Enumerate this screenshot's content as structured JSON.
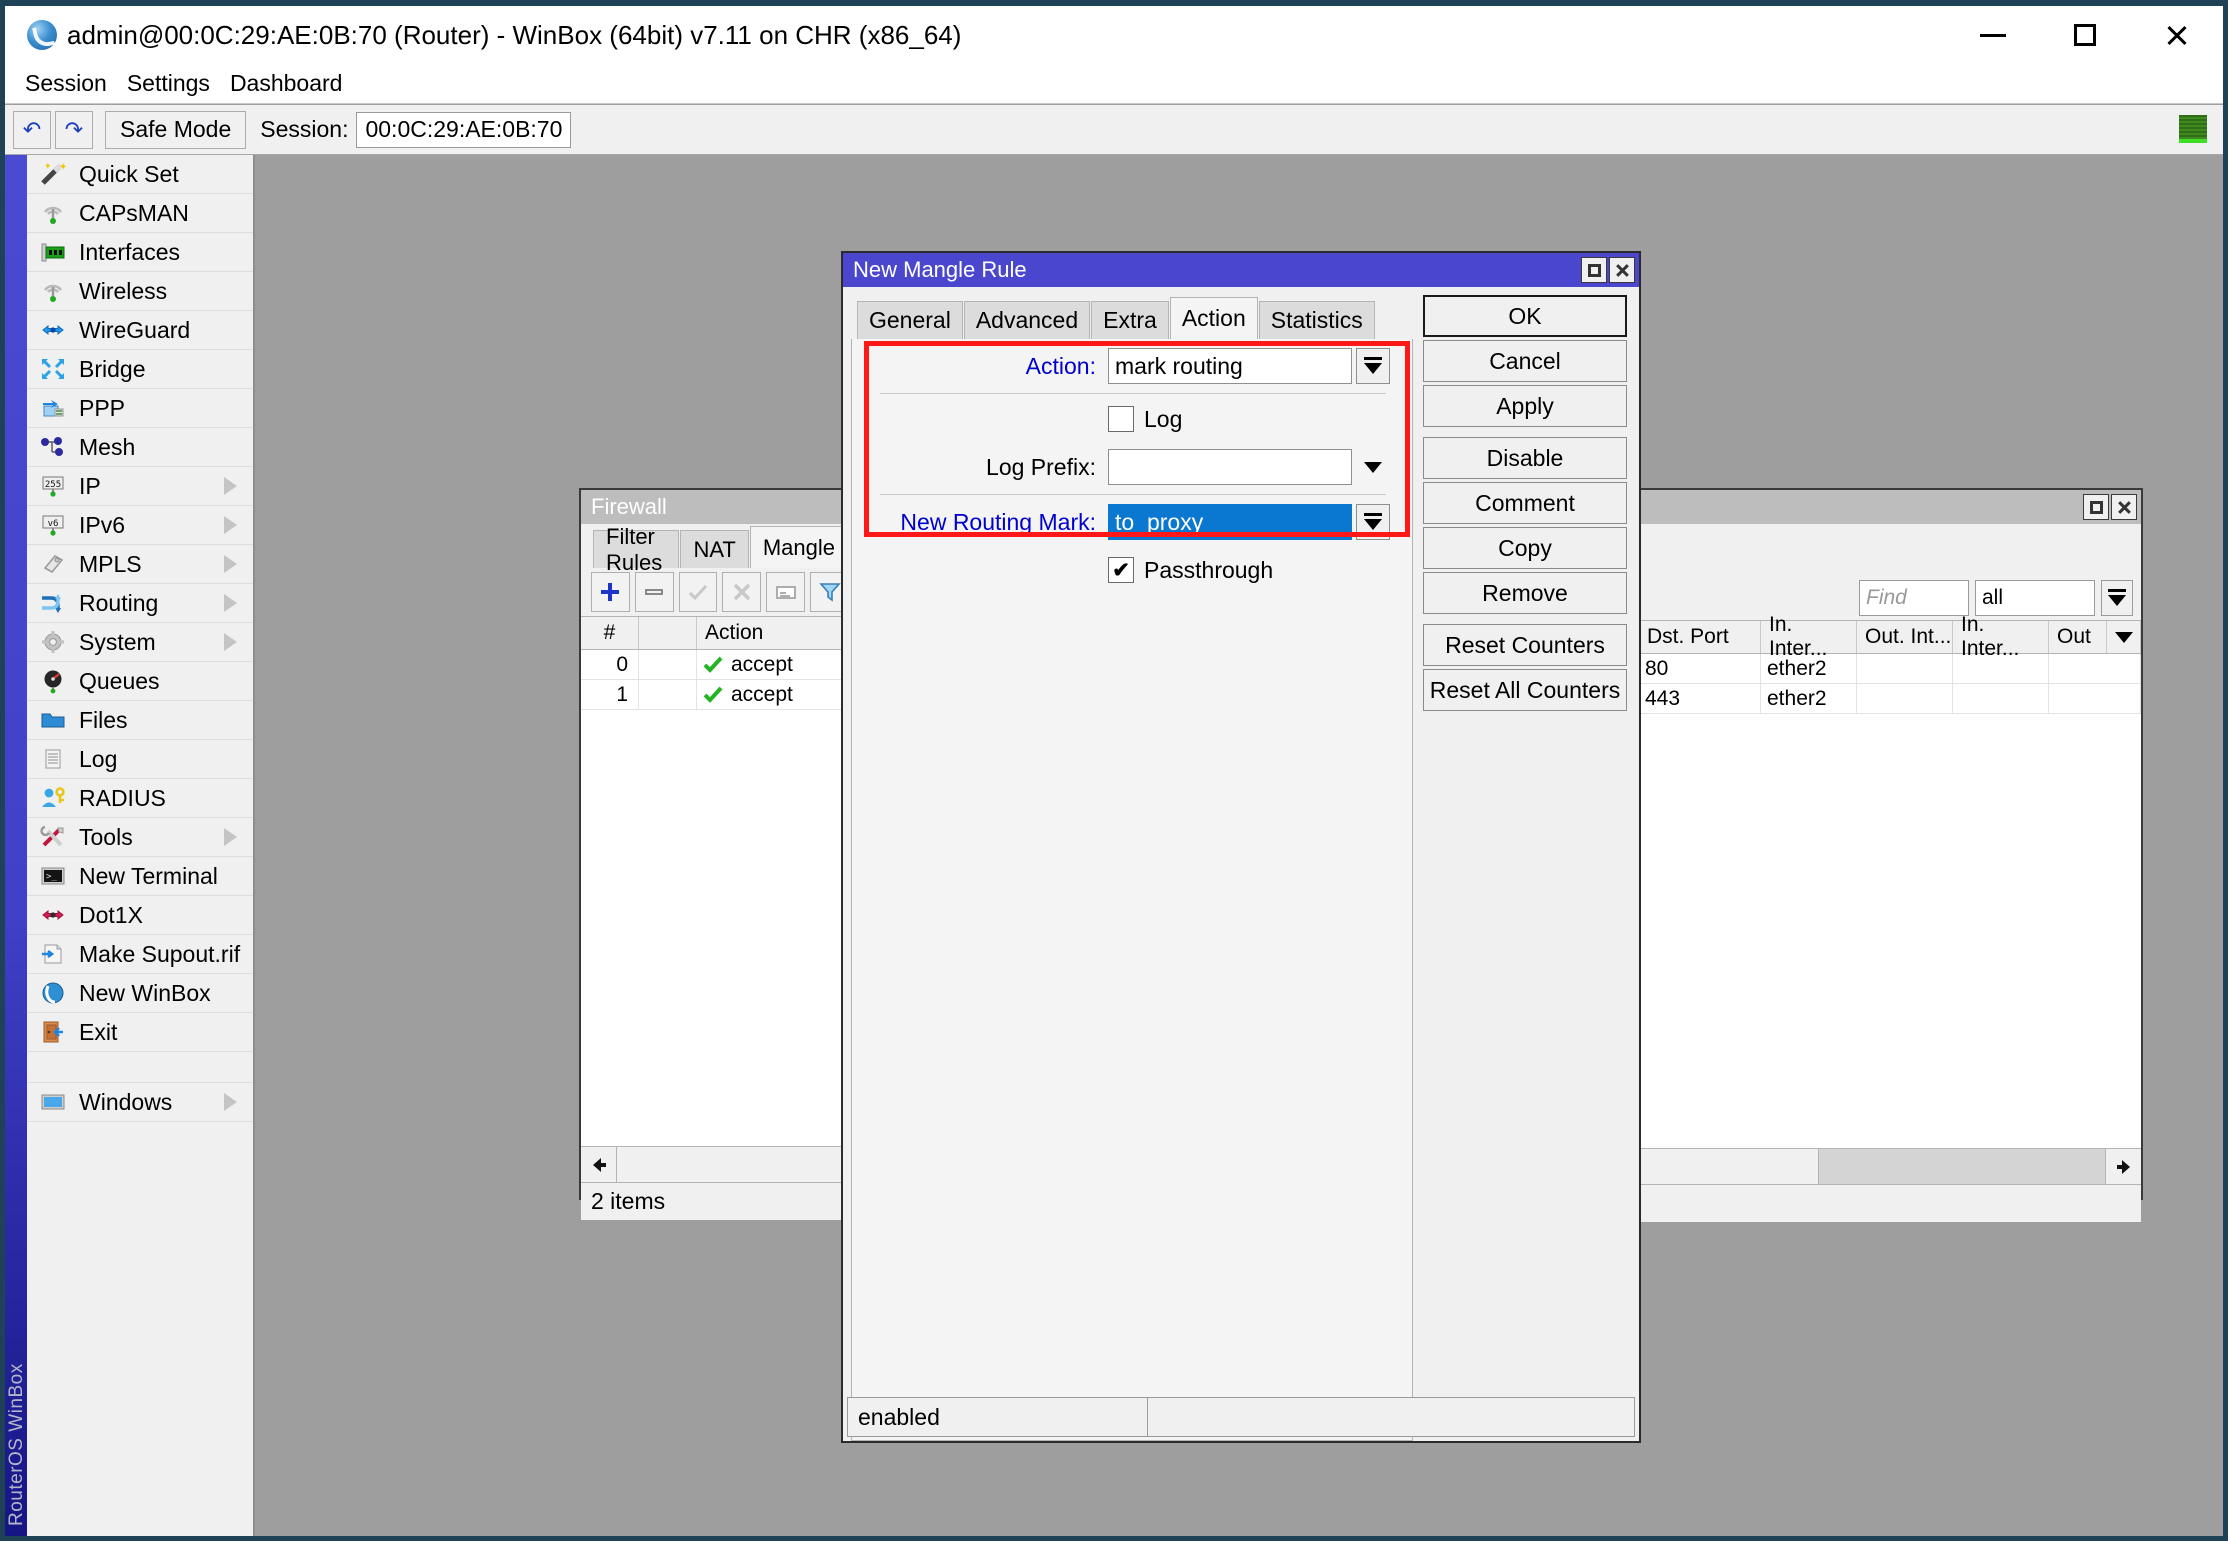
{
  "window": {
    "title": "admin@00:0C:29:AE:0B:70 (Router) - WinBox (64bit) v7.11 on CHR (x86_64)",
    "icon": "winbox-globe-icon",
    "minimize": "–",
    "maximize": "□",
    "close": "✕"
  },
  "menubar": {
    "items": [
      {
        "label": "Session"
      },
      {
        "label": "Settings"
      },
      {
        "label": "Dashboard"
      }
    ]
  },
  "toolbar": {
    "undo_icon": "↶",
    "redo_icon": "↷",
    "safe_mode": "Safe Mode",
    "session_label": "Session:",
    "session_value": "00:0C:29:AE:0B:70"
  },
  "sidebar": {
    "brand": "RouterOS WinBox",
    "items": [
      {
        "label": "Quick Set",
        "icon": "wand-icon",
        "arrow": false
      },
      {
        "label": "CAPsMAN",
        "icon": "antenna-icon",
        "arrow": false
      },
      {
        "label": "Interfaces",
        "icon": "nic-card-icon",
        "arrow": false
      },
      {
        "label": "Wireless",
        "icon": "antenna-icon",
        "arrow": false
      },
      {
        "label": "WireGuard",
        "icon": "wireguard-icon",
        "arrow": false
      },
      {
        "label": "Bridge",
        "icon": "bridge-icon",
        "arrow": false
      },
      {
        "label": "PPP",
        "icon": "ppp-icon",
        "arrow": false
      },
      {
        "label": "Mesh",
        "icon": "mesh-icon",
        "arrow": false
      },
      {
        "label": "IP",
        "icon": "ip-255-icon",
        "arrow": true
      },
      {
        "label": "IPv6",
        "icon": "ipv6-icon",
        "arrow": true
      },
      {
        "label": "MPLS",
        "icon": "mpls-tag-icon",
        "arrow": true
      },
      {
        "label": "Routing",
        "icon": "routing-icon",
        "arrow": true
      },
      {
        "label": "System",
        "icon": "gear-icon",
        "arrow": true
      },
      {
        "label": "Queues",
        "icon": "gauge-icon",
        "arrow": false
      },
      {
        "label": "Files",
        "icon": "folder-icon",
        "arrow": false
      },
      {
        "label": "Log",
        "icon": "log-page-icon",
        "arrow": false
      },
      {
        "label": "RADIUS",
        "icon": "user-key-icon",
        "arrow": false
      },
      {
        "label": "Tools",
        "icon": "tools-icon",
        "arrow": true
      },
      {
        "label": "New Terminal",
        "icon": "terminal-icon",
        "arrow": false
      },
      {
        "label": "Dot1X",
        "icon": "dot1x-icon",
        "arrow": false
      },
      {
        "label": "Make Supout.rif",
        "icon": "export-file-icon",
        "arrow": false
      },
      {
        "label": "New WinBox",
        "icon": "winbox-globe-icon",
        "arrow": false
      },
      {
        "label": "Exit",
        "icon": "exit-door-icon",
        "arrow": false
      }
    ],
    "footer_item": {
      "label": "Windows",
      "icon": "monitor-icon",
      "arrow": true
    }
  },
  "firewall_window": {
    "title": "Firewall",
    "tabs": [
      {
        "label": "Filter Rules",
        "active": false
      },
      {
        "label": "NAT",
        "active": false
      },
      {
        "label": "Mangle",
        "active": true
      }
    ],
    "toolbar_icons": [
      "add-icon",
      "remove-icon",
      "enable-icon",
      "disable-icon",
      "comment-icon",
      "filter-icon"
    ],
    "columns": [
      "#",
      "",
      "Action"
    ],
    "rows": [
      {
        "num": "0",
        "flag": "",
        "action": "accept"
      },
      {
        "num": "1",
        "flag": "",
        "action": "accept"
      }
    ],
    "status": "2 items",
    "scroll_left_icon": "arrow-left-icon"
  },
  "mangle_window": {
    "title": "",
    "find_placeholder": "Find",
    "filter_value": "all",
    "columns": [
      "Dst. Port",
      "In. Inter...",
      "Out. Int...",
      "In. Inter...",
      "Out"
    ],
    "rows": [
      {
        "dst_port": "80",
        "in_interface": "ether2",
        "out_interface": "",
        "in_interface_list": "",
        "out": ""
      },
      {
        "dst_port": "443",
        "in_interface": "ether2",
        "out_interface": "",
        "in_interface_list": "",
        "out": ""
      }
    ],
    "scroll_right_icon": "arrow-right-icon",
    "maximize": "□",
    "close": "✕"
  },
  "dialog": {
    "title": "New Mangle Rule",
    "maximize": "□",
    "close": "✕",
    "tabs": [
      {
        "label": "General",
        "active": false
      },
      {
        "label": "Advanced",
        "active": false
      },
      {
        "label": "Extra",
        "active": false
      },
      {
        "label": "Action",
        "active": true
      },
      {
        "label": "Statistics",
        "active": false
      }
    ],
    "fields": {
      "action_label": "Action:",
      "action_value": "mark routing",
      "log_label": "Log",
      "log_checked": false,
      "log_prefix_label": "Log Prefix:",
      "log_prefix_value": "",
      "new_routing_mark_label": "New Routing Mark:",
      "new_routing_mark_value": "to_proxy",
      "passthrough_label": "Passthrough",
      "passthrough_checked": true,
      "check_glyph": "✔"
    },
    "buttons": [
      {
        "label": "OK",
        "primary": true,
        "gap": false
      },
      {
        "label": "Cancel",
        "primary": false,
        "gap": false
      },
      {
        "label": "Apply",
        "primary": false,
        "gap": false
      },
      {
        "label": "Disable",
        "primary": false,
        "gap": true
      },
      {
        "label": "Comment",
        "primary": false,
        "gap": false
      },
      {
        "label": "Copy",
        "primary": false,
        "gap": false
      },
      {
        "label": "Remove",
        "primary": false,
        "gap": false
      },
      {
        "label": "Reset Counters",
        "primary": false,
        "gap": true
      },
      {
        "label": "Reset All Counters",
        "primary": false,
        "gap": false
      }
    ],
    "status_left": "enabled",
    "status_right": ""
  },
  "colors": {
    "accent_blue": "#4a46cd",
    "label_blue": "#0000cc",
    "selection_blue": "#0a78d0",
    "highlight_red": "#ff1818",
    "desktop_gray": "#9e9e9e",
    "sidebar_accent": "#4040c8",
    "status_green": "#3fdd23"
  }
}
